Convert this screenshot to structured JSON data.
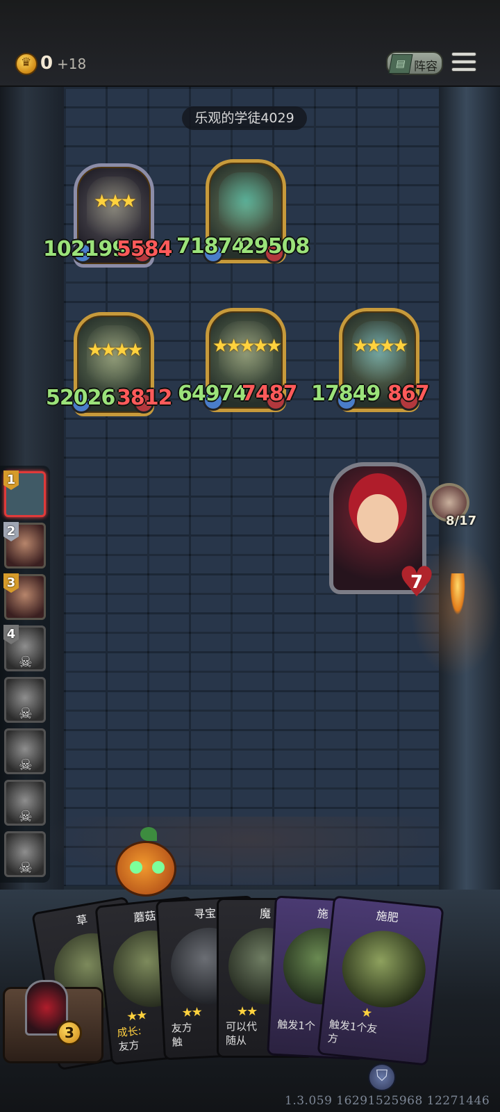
{
  "top_bar": {
    "gold": "0",
    "gold_income": "+18",
    "team_button_label": "阵容",
    "menu_icon": "hamburger-menu-icon"
  },
  "opponent": {
    "name": "乐观的学徒4029"
  },
  "enemies": [
    {
      "atk": "102199",
      "hp": "5584",
      "stars": "★★★"
    },
    {
      "atk": "71874",
      "hp": "29508",
      "stars": ""
    },
    {
      "atk": "52026",
      "hp": "3812",
      "stars": "★★★★"
    },
    {
      "atk": "64974",
      "hp": "7487",
      "stars": "★★★★★"
    },
    {
      "atk": "17849",
      "hp": "867",
      "stars": "★★★★"
    }
  ],
  "hero": {
    "health": "7",
    "turn": "8/17"
  },
  "roster": [
    {
      "num": "1",
      "state": "active"
    },
    {
      "num": "2",
      "state": "alive"
    },
    {
      "num": "3",
      "state": "alive"
    },
    {
      "num": "4",
      "state": "dead"
    },
    {
      "num": "",
      "state": "dead"
    },
    {
      "num": "",
      "state": "dead"
    },
    {
      "num": "",
      "state": "dead"
    },
    {
      "num": "",
      "state": "dead"
    }
  ],
  "hand": [
    {
      "title": "草",
      "stars": "",
      "desc_a": "",
      "desc_b": ""
    },
    {
      "title": "蘑菇",
      "stars": "★★",
      "desc_a": "成长:",
      "desc_b": "友方"
    },
    {
      "title": "寻宝",
      "stars": "★★",
      "desc_a": "友方",
      "desc_b": "触"
    },
    {
      "title": "魔",
      "stars": "★★",
      "desc_a": "可以代",
      "desc_b": "随从"
    },
    {
      "title": "施",
      "stars": "",
      "desc_a": "触发1个",
      "desc_b": ""
    },
    {
      "title": "施肥",
      "stars": "★",
      "desc_a": "触发1个友",
      "desc_b": "方"
    }
  ],
  "deck": {
    "count": "3"
  },
  "version": "1.3.059 16291525968 12271446"
}
